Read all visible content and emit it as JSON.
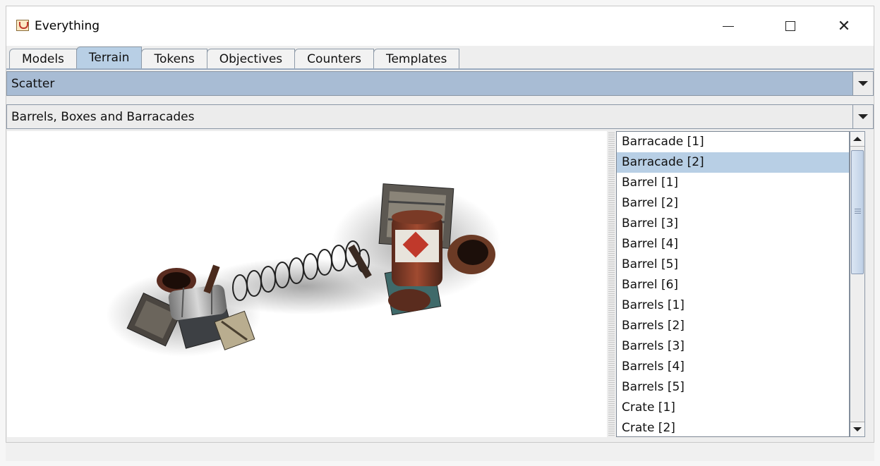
{
  "window": {
    "title": "Everything"
  },
  "tabs": [
    {
      "label": "Models"
    },
    {
      "label": "Terrain",
      "active": true
    },
    {
      "label": "Tokens"
    },
    {
      "label": "Objectives"
    },
    {
      "label": "Counters"
    },
    {
      "label": "Templates"
    }
  ],
  "category_select": {
    "value": "Scatter"
  },
  "subcategory_select": {
    "value": "Barrels, Boxes and Barracades"
  },
  "items": [
    {
      "label": "Barracade [1]"
    },
    {
      "label": "Barracade [2]",
      "selected": true
    },
    {
      "label": "Barrel [1]"
    },
    {
      "label": "Barrel [2]"
    },
    {
      "label": "Barrel [3]"
    },
    {
      "label": "Barrel [4]"
    },
    {
      "label": "Barrel [5]"
    },
    {
      "label": "Barrel [6]"
    },
    {
      "label": "Barrels [1]"
    },
    {
      "label": "Barrels [2]"
    },
    {
      "label": "Barrels [3]"
    },
    {
      "label": "Barrels [4]"
    },
    {
      "label": "Barrels [5]"
    },
    {
      "label": "Crate [1]"
    },
    {
      "label": "Crate [2]"
    }
  ],
  "icons": {
    "app": "java-cup-icon",
    "minimize": "minimize-icon",
    "maximize": "maximize-icon",
    "close": "close-icon"
  },
  "colors": {
    "selection": "#b8cfe5",
    "active_combo": "#a8bcd4"
  }
}
